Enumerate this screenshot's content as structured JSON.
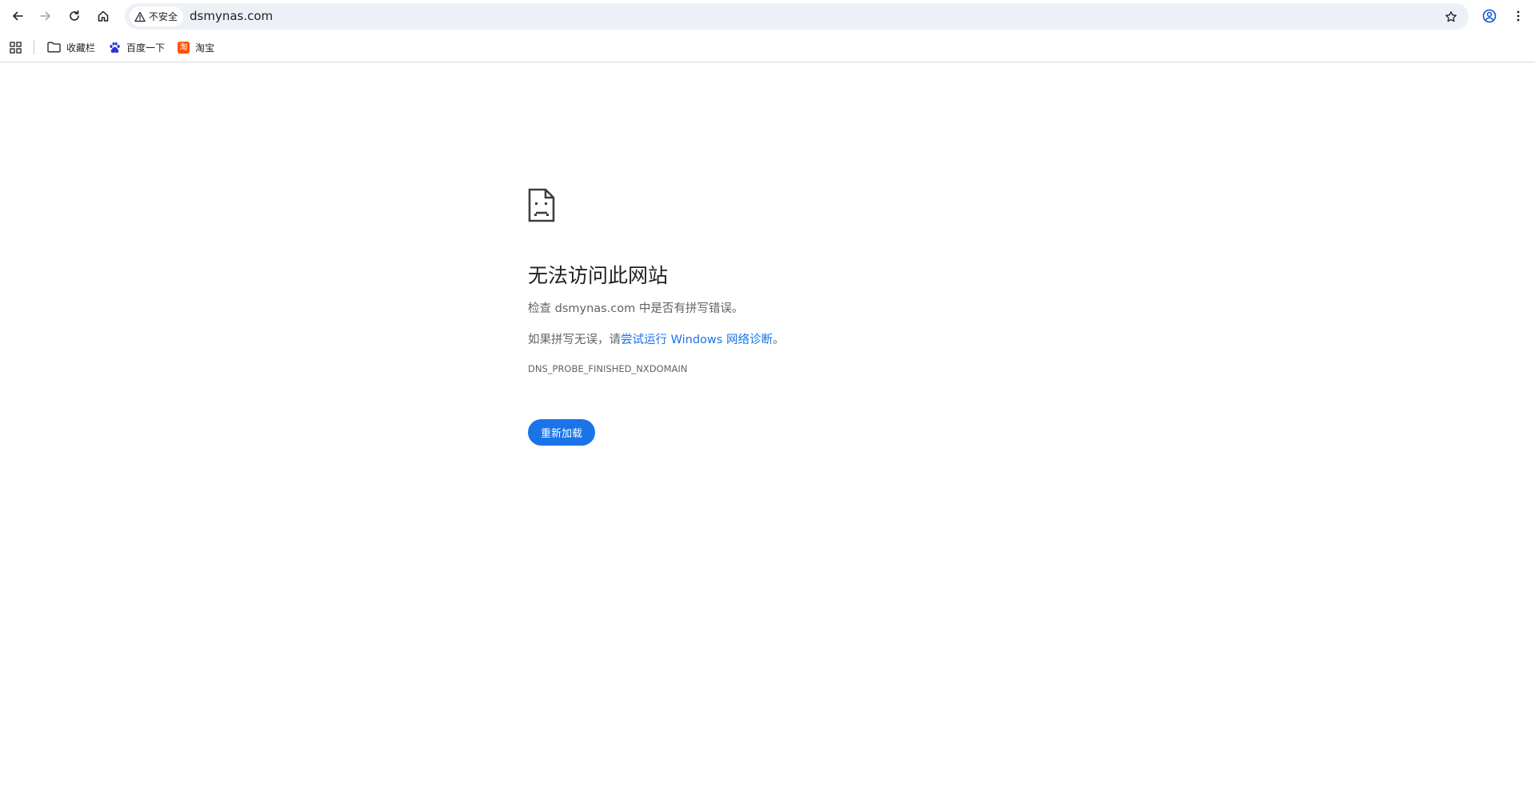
{
  "browser": {
    "security_label": "不安全",
    "url": "dsmynas.com"
  },
  "bookmarks": [
    {
      "label": "收藏栏",
      "icon": "folder-icon"
    },
    {
      "label": "百度一下",
      "icon": "baidu-icon"
    },
    {
      "label": "淘宝",
      "icon": "taobao-icon",
      "icon_text": "淘"
    }
  ],
  "error": {
    "title": "无法访问此网站",
    "line1": "检查 dsmynas.com 中是否有拼写错误。",
    "line2_prefix": "如果拼写无误，请",
    "line2_link": "尝试运行 Windows 网络诊断",
    "line2_suffix": "。",
    "code": "DNS_PROBE_FINISHED_NXDOMAIN",
    "reload_label": "重新加载"
  },
  "colors": {
    "accent": "#1a73e8",
    "omnibox_bg": "#edf0f7",
    "taobao": "#ff5000",
    "baidu": "#2932e1"
  }
}
